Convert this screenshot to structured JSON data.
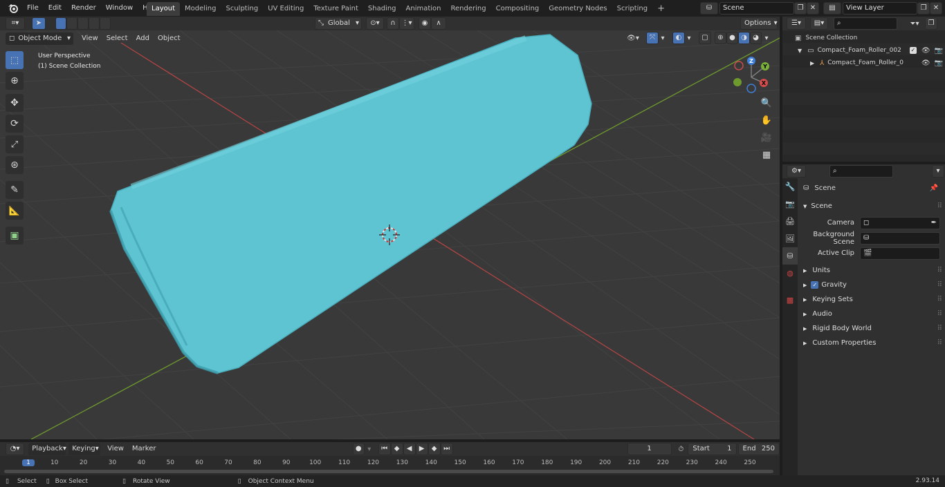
{
  "top_menu": {
    "items": [
      "File",
      "Edit",
      "Render",
      "Window",
      "Help"
    ]
  },
  "workspaces": {
    "tabs": [
      "Layout",
      "Modeling",
      "Sculpting",
      "UV Editing",
      "Texture Paint",
      "Shading",
      "Animation",
      "Rendering",
      "Compositing",
      "Geometry Nodes",
      "Scripting"
    ],
    "active": "Layout",
    "add_label": "+"
  },
  "scene_selector": {
    "value": "Scene"
  },
  "view_layer_selector": {
    "value": "View Layer"
  },
  "tool_header": {
    "orientation": "Global",
    "options_label": "Options"
  },
  "viewport_header": {
    "mode": "Object Mode",
    "menus": [
      "View",
      "Select",
      "Add",
      "Object"
    ]
  },
  "viewport_overlay": {
    "line1": "User Perspective",
    "line2": "(1) Scene Collection"
  },
  "gizmo": {
    "axes": [
      "Z",
      "Y",
      "X"
    ]
  },
  "object": {
    "color": "#5ec4d2",
    "name": "Compact_Foam_Roller"
  },
  "outliner": {
    "root": "Scene Collection",
    "items": [
      {
        "label": "Compact_Foam_Roller_002",
        "type": "collection"
      },
      {
        "label": "Compact_Foam_Roller_0",
        "type": "object"
      }
    ]
  },
  "properties": {
    "context": "Scene",
    "panel": "Scene",
    "fields": [
      {
        "label": "Camera",
        "value": ""
      },
      {
        "label": "Background Scene",
        "value": ""
      },
      {
        "label": "Active Clip",
        "value": ""
      }
    ],
    "subpanels": [
      "Units",
      "Gravity",
      "Keying Sets",
      "Audio",
      "Rigid Body World",
      "Custom Properties"
    ],
    "gravity_checked": true
  },
  "timeline": {
    "menus": [
      "Playback",
      "Keying",
      "View",
      "Marker"
    ],
    "current_frame": "1",
    "start_label": "Start",
    "start_value": "1",
    "end_label": "End",
    "end_value": "250",
    "ruler": [
      "1",
      "10",
      "20",
      "30",
      "40",
      "50",
      "60",
      "70",
      "80",
      "90",
      "100",
      "110",
      "120",
      "130",
      "140",
      "150",
      "160",
      "170",
      "180",
      "190",
      "200",
      "210",
      "220",
      "230",
      "240",
      "250"
    ]
  },
  "statusbar": {
    "select": "Select",
    "box_select": "Box Select",
    "rotate_view": "Rotate View",
    "context_menu": "Object Context Menu",
    "version": "2.93.14"
  },
  "colors": {
    "accent": "#4772b3",
    "x_axis": "#d44c4c",
    "y_axis": "#7ab03a",
    "z_axis": "#3f7fd8"
  }
}
